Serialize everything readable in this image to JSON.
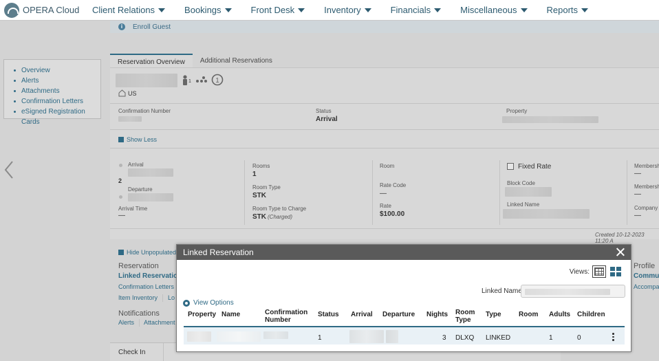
{
  "nav": {
    "app_name": "OPERA Cloud",
    "menu": [
      "Client Relations",
      "Bookings",
      "Front Desk",
      "Inventory",
      "Financials",
      "Miscellaneous",
      "Reports"
    ]
  },
  "banner": {
    "text": "Enroll Guest"
  },
  "side_nav": [
    "Overview",
    "Alerts",
    "Attachments",
    "Confirmation Letters",
    "eSigned Registration Cards"
  ],
  "tabs": [
    "Reservation Overview",
    "Additional Reservations"
  ],
  "overview": {
    "adults_count": "1",
    "country": "US",
    "confirmation_number_label": "Confirmation Number",
    "status_label": "Status",
    "status_value": "Arrival",
    "property_label": "Property",
    "show_less": "Show Less",
    "arrival_label": "Arrival",
    "nights": "2",
    "departure_label": "Departure",
    "arrival_time_label": "Arrival Time",
    "arrival_time_value": "—",
    "rooms_label": "Rooms",
    "rooms_value": "1",
    "room_type_label": "Room Type",
    "room_type_value": "STK",
    "room_type_charge_label": "Room Type to Charge",
    "room_type_charge_value": "STK",
    "charged_note": "(Charged)",
    "room_label": "Room",
    "rate_code_label": "Rate Code",
    "rate_code_value": "—",
    "rate_label": "Rate",
    "rate_value": "$100.00",
    "fixed_rate_label": "Fixed Rate",
    "block_code_label": "Block Code",
    "linked_name_label": "Linked Name",
    "membership_label_1": "Membersh",
    "membership_value_1": "—",
    "membership_label_2": "Membersh",
    "membership_value_2": "—",
    "company_label": "Company",
    "company_value": "—",
    "created_text": "Created 10-12-2023 11:20 A",
    "hide_unpopulated": "Hide Unpopulated",
    "reservation_heading": "Reservation",
    "linked_reservation": "Linked Reservation",
    "confirmation_letters": "Confirmation Letters",
    "item_inventory": "Item Inventory",
    "lo_link": "Lo",
    "notifications_heading": "Notifications",
    "alerts_link": "Alerts",
    "attachments_link": "Attachment",
    "profile_heading": "Profile",
    "profile_link": "Commun",
    "profile_link2": "Accompa"
  },
  "bottom_bar": [
    "Check In"
  ],
  "modal": {
    "title": "Linked Reservation",
    "views_label": "Views:",
    "linked_name_label": "Linked Name",
    "view_options": "View Options",
    "columns": [
      "Property",
      "Name",
      "Confirmation Number",
      "Status",
      "Arrival",
      "Departure",
      "Nights",
      "Room Type",
      "Type",
      "Room",
      "Adults",
      "Children"
    ],
    "row": {
      "status": "1",
      "nights": "3",
      "room_type": "DLXQ",
      "type": "LINKED",
      "adults": "1",
      "children": "0"
    }
  }
}
